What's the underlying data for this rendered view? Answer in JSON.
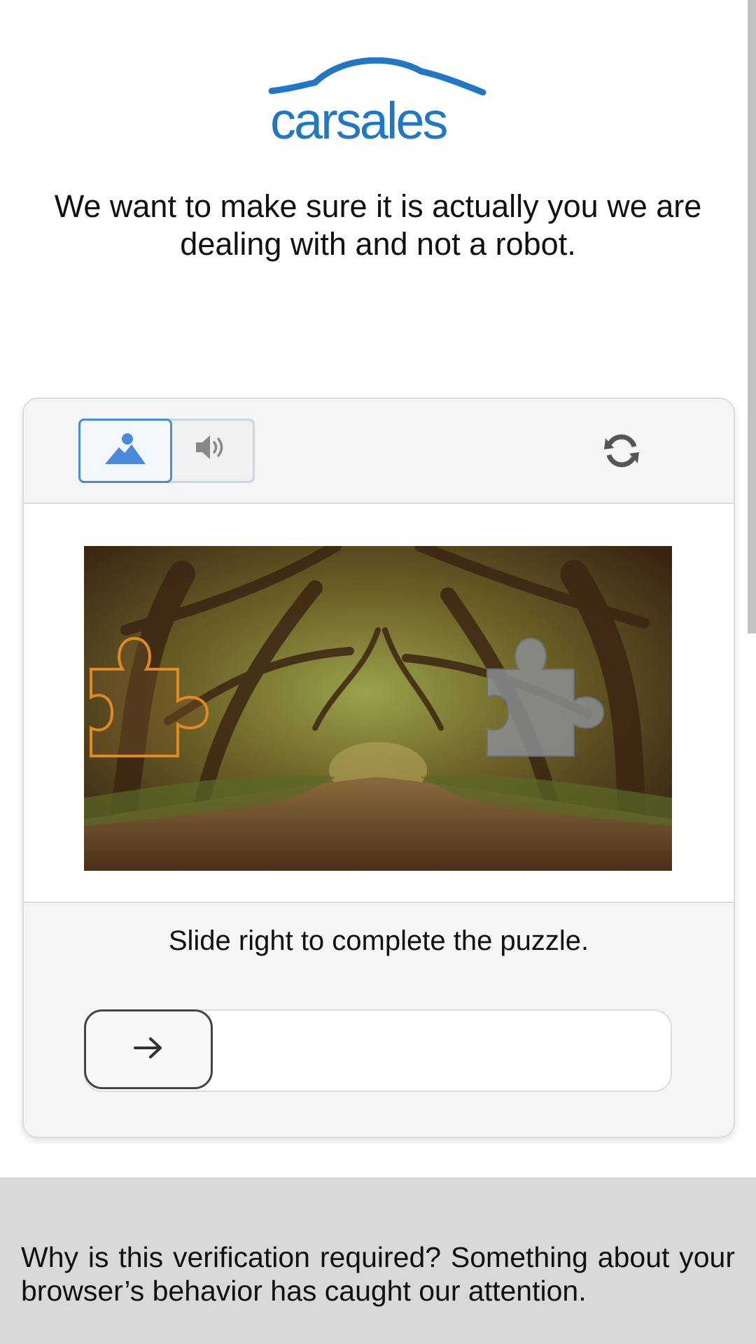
{
  "brand": {
    "logo_text": "carsales",
    "color": "#1f77c6"
  },
  "intro_text": "We want to make sure it is actually you we are dealing with and not a robot.",
  "captcha": {
    "modes": [
      {
        "label": "image",
        "icon": "image-icon",
        "active": true
      },
      {
        "label": "audio",
        "icon": "speaker-icon",
        "active": false
      }
    ],
    "refresh_icon": "refresh-icon",
    "instruction": "Slide right to complete the puzzle.",
    "slider_icon": "arrow-right-icon",
    "accent_color": "#4a8ad8"
  },
  "footer": {
    "text": "Why is this verification required? Something about your browser’s behavior has caught our attention."
  }
}
